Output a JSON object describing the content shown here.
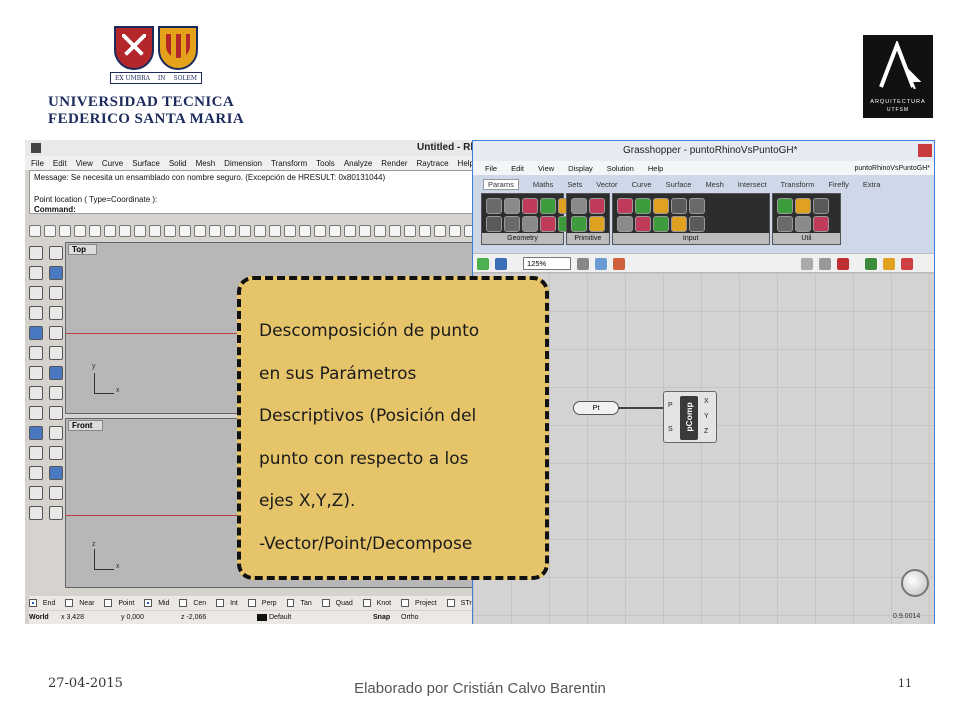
{
  "header": {
    "crest_motto_left": "EX UMBRA",
    "crest_motto_mid": "IN",
    "crest_motto_right": "SOLEM",
    "university_line1": "UNIVERSIDAD TECNICA",
    "university_line2": "FEDERICO SANTA MARIA",
    "arq_line1": "ARQUITECTURA",
    "arq_line2": "UTFSM"
  },
  "rhino": {
    "title": "Untitled - Rhino",
    "menu": [
      "File",
      "Edit",
      "View",
      "Curve",
      "Surface",
      "Solid",
      "Mesh",
      "Dimension",
      "Transform",
      "Tools",
      "Analyze",
      "Render",
      "Raytrace",
      "Help"
    ],
    "command_message": "Message: Se necesita un ensamblado con nombre seguro. (Excepción de HRESULT: 0x80131044)",
    "command_prompt": "Point location ( Type=Coordinate ):",
    "command_label": "Command:",
    "viewport_top": "Top",
    "viewport_front": "Front",
    "axis_x": "x",
    "axis_y": "y",
    "axis_z": "z",
    "snaps": [
      {
        "label": "End",
        "checked": true
      },
      {
        "label": "Near",
        "checked": false
      },
      {
        "label": "Point",
        "checked": false
      },
      {
        "label": "Mid",
        "checked": true
      },
      {
        "label": "Cen",
        "checked": false
      },
      {
        "label": "Int",
        "checked": false
      },
      {
        "label": "Perp",
        "checked": false
      },
      {
        "label": "Tan",
        "checked": false
      },
      {
        "label": "Quad",
        "checked": false
      },
      {
        "label": "Knot",
        "checked": false
      },
      {
        "label": "Project",
        "checked": false
      },
      {
        "label": "STrac",
        "checked": false
      }
    ],
    "status": {
      "cplane": "World",
      "x": "x 3,428",
      "y": "y 0,000",
      "z": "z -2,066",
      "layer": "Default",
      "snap": "Snap",
      "ortho": "Ortho"
    }
  },
  "grasshopper": {
    "title": "Grasshopper - puntoRhinoVsPuntoGH*",
    "menu": [
      "File",
      "Edit",
      "View",
      "Display",
      "Solution",
      "Help"
    ],
    "doc_name": "puntoRhinoVsPuntoGH*",
    "tabs": [
      "Params",
      "Maths",
      "Sets",
      "Vector",
      "Curve",
      "Surface",
      "Mesh",
      "Intersect",
      "Transform",
      "Firefly",
      "Extra"
    ],
    "active_tab": "Params",
    "ribbon_groups": [
      "Geometry",
      "Primitive",
      "Input",
      "Util"
    ],
    "zoom": "125%",
    "pt_node": "Pt",
    "comp_name": "pComp",
    "comp_inputs": [
      "P",
      "S"
    ],
    "comp_outputs": [
      "X",
      "Y",
      "Z"
    ],
    "version": "0.9.0014"
  },
  "callout": {
    "lines": [
      "Descomposición de punto",
      "en sus Parámetros",
      "Descriptivos (Posición del",
      "punto con respecto a los",
      "ejes X,Y,Z).",
      "-Vector/Point/Decompose"
    ]
  },
  "footer": {
    "date": "27-04-2015",
    "author": "Elaborado por Cristián Calvo Barentin",
    "page": "11"
  },
  "colors": {
    "callout_bg": "#e6c46a",
    "navy": "#1c2a5c",
    "crest_red": "#b3262a",
    "crest_gold": "#e3a21a"
  }
}
